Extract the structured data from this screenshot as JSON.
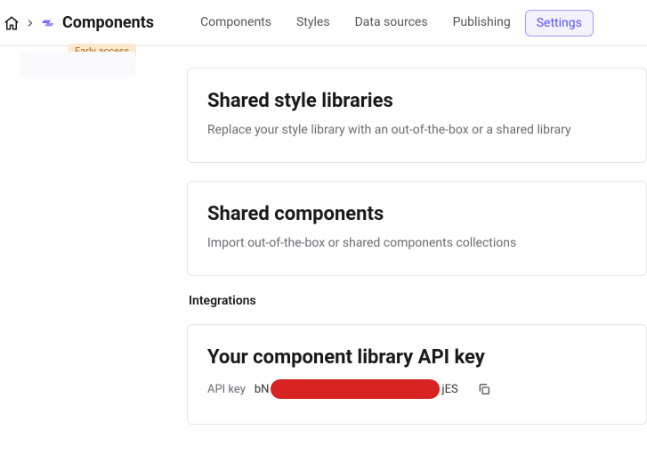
{
  "breadcrumb": {
    "title": "Components",
    "badge": "Early access"
  },
  "tabs": [
    {
      "label": "Components",
      "active": false
    },
    {
      "label": "Styles",
      "active": false
    },
    {
      "label": "Data sources",
      "active": false
    },
    {
      "label": "Publishing",
      "active": false
    },
    {
      "label": "Settings",
      "active": true
    }
  ],
  "cards": {
    "styleLib": {
      "title": "Shared style libraries",
      "desc": "Replace your style library with an out-of-the-box or a shared library"
    },
    "sharedComp": {
      "title": "Shared components",
      "desc": "Import out-of-the-box or shared components collections"
    },
    "apiKey": {
      "title": "Your component library API key",
      "label": "API key",
      "prefix": "bN",
      "suffix": "jES"
    }
  },
  "sections": {
    "integrations": "Integrations"
  }
}
